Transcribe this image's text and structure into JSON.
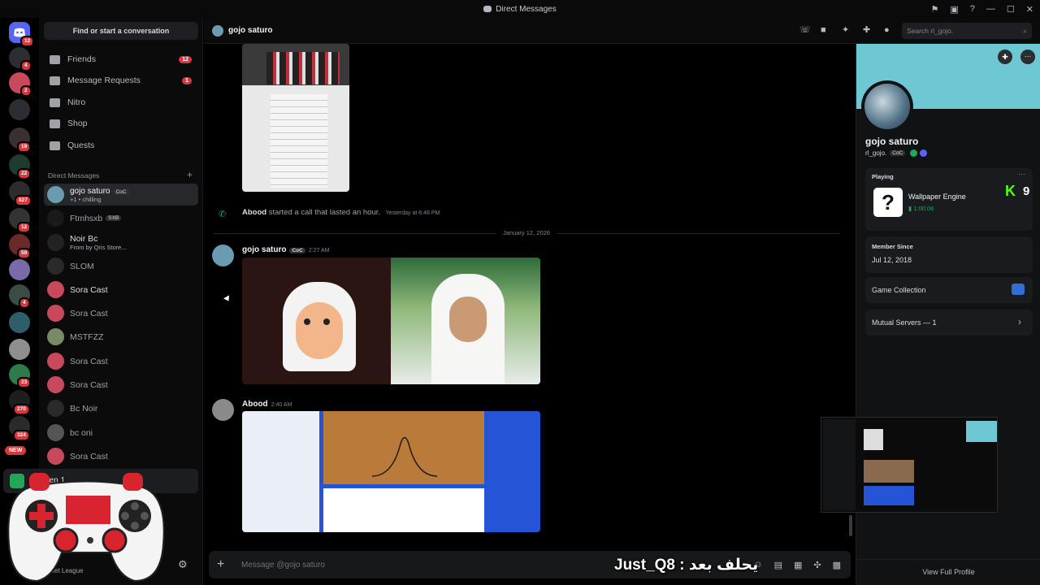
{
  "window": {
    "title": "Direct Messages",
    "controls": [
      "—",
      "☐",
      "✕"
    ]
  },
  "rail": {
    "servers": [
      {
        "badge": "12"
      },
      {
        "badge": "4"
      },
      {
        "badge": "2"
      },
      {
        "badge": ""
      },
      {
        "badge": "19"
      },
      {
        "badge": "22"
      },
      {
        "badge": "827"
      },
      {
        "badge": "12"
      },
      {
        "badge": "59"
      },
      {
        "badge": ""
      },
      {
        "badge": "4"
      },
      {
        "badge": ""
      },
      {
        "badge": ""
      },
      {
        "badge": "23"
      },
      {
        "badge": "270"
      },
      {
        "badge": "324"
      }
    ],
    "new_label": "NEW"
  },
  "sidebar": {
    "find_placeholder": "Find or start a conversation",
    "nav": [
      {
        "label": "Friends",
        "count": "12"
      },
      {
        "label": "Message Requests",
        "count": "1"
      },
      {
        "label": "Nitro",
        "count": ""
      },
      {
        "label": "Shop",
        "count": ""
      },
      {
        "label": "Quests",
        "count": ""
      }
    ],
    "dm_header": "Direct Messages",
    "dms": [
      {
        "name": "gojo saturo",
        "tag": "CoC",
        "sub": "+1 • chilling",
        "active": true
      },
      {
        "name": "Ftmhsxb",
        "tag": "SXB",
        "sub": ""
      },
      {
        "name": "Noir Bc",
        "tag": "",
        "sub": "From by Qris Store..."
      },
      {
        "name": "SLOM",
        "tag": "",
        "sub": ""
      },
      {
        "name": "Sora Cast",
        "tag": "",
        "sub": ""
      },
      {
        "name": "Sora Cast",
        "tag": "",
        "sub": ""
      },
      {
        "name": "MSTFZZ",
        "tag": "",
        "sub": ""
      },
      {
        "name": "Sora Cast",
        "tag": "",
        "sub": ""
      },
      {
        "name": "Sora Cast",
        "tag": "",
        "sub": ""
      },
      {
        "name": "Bc Noir",
        "tag": "",
        "sub": ""
      },
      {
        "name": "bc oni",
        "tag": "",
        "sub": ""
      },
      {
        "name": "Sora Cast",
        "tag": "",
        "sub": ""
      }
    ],
    "screen_share_label": "Screen 1",
    "user_sub": "cket League"
  },
  "header": {
    "channel_name": "gojo saturo",
    "search_placeholder": "Search rl_gojo."
  },
  "chat": {
    "call_event": {
      "author": "Abood",
      "text": "started a call that lasted an hour.",
      "time": "Yesterday at 6:48 PM"
    },
    "date_divider": "January 12, 2026",
    "messages": [
      {
        "author": "gojo saturo",
        "tag": "CoC",
        "time": "2:27 AM"
      },
      {
        "author": "Abood",
        "time": "2:40 AM"
      }
    ],
    "composer_placeholder": "Message @gojo saturo",
    "overlay_text": "Just_Q8 : يحلف بعد"
  },
  "profile": {
    "display_name": "gojo saturo",
    "username": "rl_gojo.",
    "tag": "CoC",
    "playing_label": "Playing",
    "game_name": "Wallpaper Engine",
    "game_time": "1:00:06",
    "kick_count": "9",
    "member_since_label": "Member Since",
    "member_since": "Jul 12, 2018",
    "game_collection": "Game Collection",
    "mutual_servers": "Mutual Servers — 1",
    "view_full": "View Full Profile"
  },
  "colors": {
    "accent": "#5865f2",
    "badge": "#da373c",
    "banner": "#6ec8d3",
    "online": "#23a55a"
  }
}
